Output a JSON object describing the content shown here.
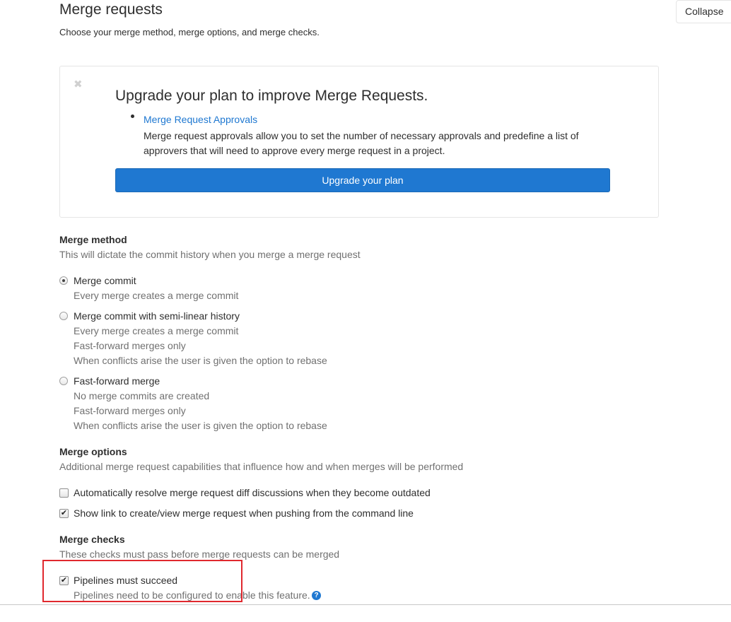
{
  "header": {
    "title": "Merge requests",
    "subtitle": "Choose your merge method, merge options, and merge checks.",
    "collapse_label": "Collapse"
  },
  "promo": {
    "close_glyph": "✖",
    "title": "Upgrade your plan to improve Merge Requests.",
    "feature_link": "Merge Request Approvals",
    "feature_desc": "Merge request approvals allow you to set the number of necessary approvals and predefine a list of approvers that will need to approve every merge request in a project.",
    "button_label": "Upgrade your plan"
  },
  "merge_method": {
    "title": "Merge method",
    "description": "This will dictate the commit history when you merge a merge request",
    "options": [
      {
        "label": "Merge commit",
        "checked": true,
        "help": [
          "Every merge creates a merge commit"
        ]
      },
      {
        "label": "Merge commit with semi-linear history",
        "checked": false,
        "help": [
          "Every merge creates a merge commit",
          "Fast-forward merges only",
          "When conflicts arise the user is given the option to rebase"
        ]
      },
      {
        "label": "Fast-forward merge",
        "checked": false,
        "help": [
          "No merge commits are created",
          "Fast-forward merges only",
          "When conflicts arise the user is given the option to rebase"
        ]
      }
    ]
  },
  "merge_options": {
    "title": "Merge options",
    "description": "Additional merge request capabilities that influence how and when merges will be performed",
    "options": [
      {
        "label": "Automatically resolve merge request diff discussions when they become outdated",
        "checked": false
      },
      {
        "label": "Show link to create/view merge request when pushing from the command line",
        "checked": true
      }
    ]
  },
  "merge_checks": {
    "title": "Merge checks",
    "description": "These checks must pass before merge requests can be merged",
    "options": [
      {
        "label": "Pipelines must succeed",
        "checked": true,
        "help": "Pipelines need to be configured to enable this feature."
      }
    ]
  },
  "icons": {
    "check_glyph": "✔",
    "help_glyph": "?"
  },
  "colors": {
    "link": "#1f78d1",
    "primary_button": "#1f78d1",
    "highlight_box": "#e0282e"
  }
}
